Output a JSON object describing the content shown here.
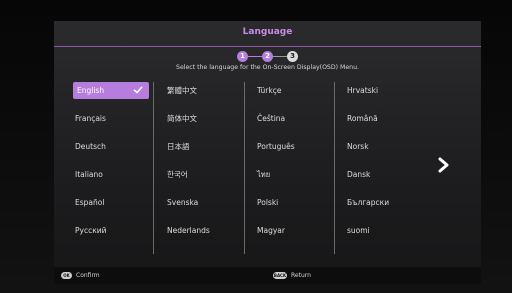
{
  "dialog": {
    "title": "Language",
    "subtitle": "Select the language for the On-Screen Display(OSD) Menu."
  },
  "steps": [
    "1",
    "2",
    "3"
  ],
  "languages": {
    "col1": [
      "English",
      "Français",
      "Deutsch",
      "Italiano",
      "Español",
      "Русский"
    ],
    "col2": [
      "繁體中文",
      "简体中文",
      "日本語",
      "한국어",
      "Svenska",
      "Nederlands"
    ],
    "col3": [
      "Türkçe",
      "Čeština",
      "Português",
      "ไทย",
      "Polski",
      "Magyar"
    ],
    "col4": [
      "Hrvatski",
      "Română",
      "Norsk",
      "Dansk",
      "Български",
      "suomi"
    ]
  },
  "selected_language": "English",
  "footer": {
    "confirm_key": "OK",
    "confirm_label": "Confirm",
    "return_key": "BACK",
    "return_label": "Return"
  },
  "colors": {
    "accent": "#b67cde",
    "step_inactive": "#dcdcdc",
    "page_dot_active": "#b67cde",
    "page_dot_inactive": "#8a8a8a"
  },
  "icons": {
    "selected": "check-icon",
    "next_page": "chevron-right-icon"
  }
}
